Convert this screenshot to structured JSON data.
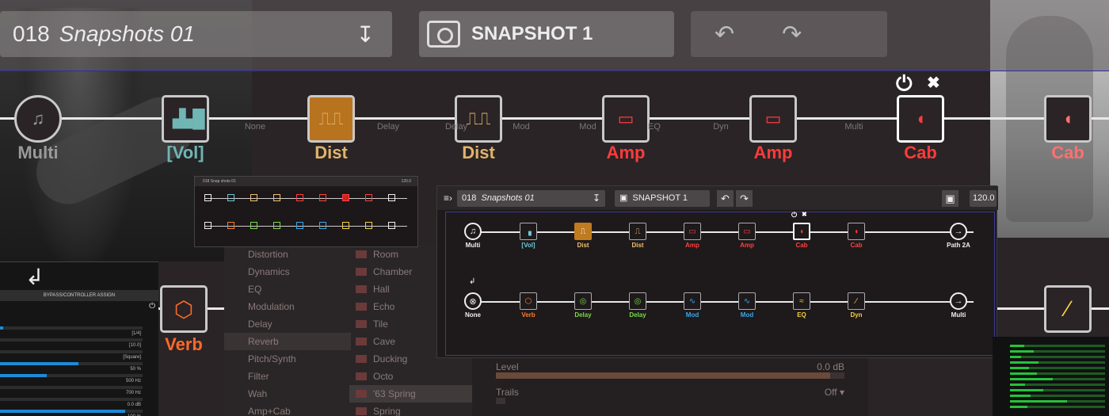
{
  "header": {
    "preset_number": "018",
    "preset_name": "Snapshots 01",
    "snapshot_name": "SNAPSHOT 1"
  },
  "big_chain": {
    "path1_blocks": [
      {
        "label": "Multi",
        "color": "#9a9a9a"
      },
      {
        "label": "[Vol]",
        "color": "#6fb6b5"
      },
      {
        "label": "Dist",
        "color": "#e0b46a"
      },
      {
        "label": "Dist",
        "color": "#e0b46a"
      },
      {
        "label": "Amp",
        "color": "#ff3b3b"
      },
      {
        "label": "Amp",
        "color": "#ff3b3b"
      },
      {
        "label": "Cab",
        "color": "#ff3b3b"
      },
      {
        "label": "Cab",
        "color": "#ff7070"
      }
    ],
    "ghost_labels": [
      "None",
      "Delay",
      "Delay",
      "Mod",
      "Mod",
      "EQ",
      "Dyn",
      "Multi",
      "Multi",
      "[Vol]",
      "Dist",
      "Cab",
      "Path 2A"
    ],
    "path2_blocks": [
      {
        "label": "Verb",
        "color": "#ff6a2a"
      },
      {
        "label": "Delay",
        "color": "#6fd23a"
      }
    ]
  },
  "bypass_panel": {
    "title": "BYPASS/CONTROLLER ASSIGN",
    "rows": [
      {
        "value": "",
        "fill": 0.02
      },
      {
        "value": "[1/4]",
        "fill": 0.0
      },
      {
        "value": "[10.0]",
        "fill": 0.0
      },
      {
        "value": "[Square]",
        "fill": 0.55
      },
      {
        "value": "50 %",
        "fill": 0.33
      },
      {
        "value": "500 Hz",
        "fill": 0.0
      },
      {
        "value": "700 Hz",
        "fill": 0.0
      },
      {
        "value": "0.0 dB",
        "fill": 0.88
      },
      {
        "value": "100 %",
        "fill": 0.0
      }
    ]
  },
  "model_list": {
    "categories": [
      "Distortion",
      "Dynamics",
      "EQ",
      "Modulation",
      "Delay",
      "Reverb",
      "Pitch/Synth",
      "Filter",
      "Wah",
      "Amp+Cab"
    ],
    "selected_category": "Reverb",
    "models": [
      "Room",
      "Chamber",
      "Hall",
      "Echo",
      "Tile",
      "Cave",
      "Ducking",
      "Octo",
      "'63 Spring",
      "Spring"
    ],
    "selected_model": "'63 Spring"
  },
  "params": {
    "level_label": "Level",
    "level_value": "0.0 dB",
    "level_fill": 0.96,
    "trails_label": "Trails",
    "trails_value": "Off"
  },
  "thumbnail": {
    "preset_label": "018  Snap shots 01",
    "tempo": "120.0"
  },
  "main_ui": {
    "preset_number": "018",
    "preset_name": "Snapshots 01",
    "snapshot_name": "SNAPSHOT 1",
    "tempo": "120.0",
    "path1": {
      "input": "Multi",
      "output": "Path 2A",
      "blocks": [
        {
          "label": "[Vol]",
          "color": "#6fc7d6"
        },
        {
          "label": "Dist",
          "color": "#f0c070",
          "filled": true
        },
        {
          "label": "Dist",
          "color": "#f0c070"
        },
        {
          "label": "Amp",
          "color": "#ff4040"
        },
        {
          "label": "Amp",
          "color": "#ff4040"
        },
        {
          "label": "Cab",
          "color": "#ff4040",
          "selected": true
        },
        {
          "label": "Cab",
          "color": "#ff4040"
        }
      ]
    },
    "path2": {
      "input": "None",
      "output": "Multi",
      "blocks": [
        {
          "label": "Verb",
          "color": "#ff7a30"
        },
        {
          "label": "Delay",
          "color": "#7ad84a"
        },
        {
          "label": "Delay",
          "color": "#7ad84a"
        },
        {
          "label": "Mod",
          "color": "#3aa8e8"
        },
        {
          "label": "Mod",
          "color": "#3aa8e8"
        },
        {
          "label": "EQ",
          "color": "#f5d040"
        },
        {
          "label": "Dyn",
          "color": "#f5d040"
        }
      ]
    }
  },
  "right_panel": {
    "bars": [
      0.15,
      0.25,
      0.12,
      0.3,
      0.2,
      0.28,
      0.45,
      0.16,
      0.35,
      0.22,
      0.6,
      0.18
    ]
  }
}
